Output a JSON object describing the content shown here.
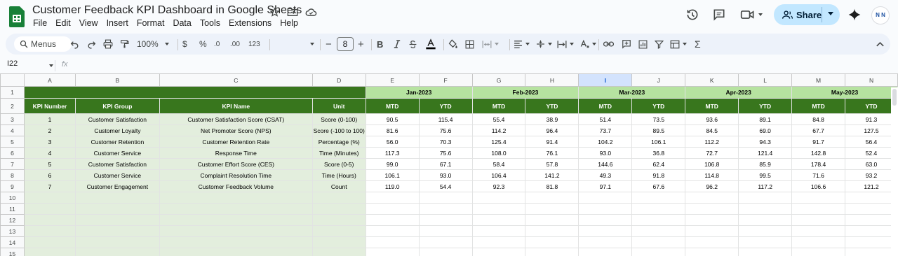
{
  "app": {
    "doc_title": "Customer Feedback KPI Dashboard in Google Sheets",
    "menu": [
      "File",
      "Edit",
      "View",
      "Insert",
      "Format",
      "Data",
      "Tools",
      "Extensions",
      "Help"
    ],
    "share_label": "Share",
    "avatar_text": "N N",
    "brand_color": "#188038",
    "share_bg": "#c2e7ff"
  },
  "toolbar": {
    "menus_label": "Menus",
    "zoom": "100%",
    "currency": "$",
    "percent": "%",
    "dec_dec": ".0",
    "dec_inc": ".00",
    "number_format": "123",
    "font_size": "8",
    "minus": "−",
    "plus": "+",
    "bold": "B",
    "sum": "Σ"
  },
  "formula_bar": {
    "cell_ref": "I22",
    "fx": "fx",
    "content": ""
  },
  "sheet": {
    "selected_column": "I",
    "column_letters": [
      "A",
      "B",
      "C",
      "D",
      "E",
      "F",
      "G",
      "H",
      "I",
      "J",
      "K",
      "L",
      "M",
      "N"
    ],
    "months": [
      "Jan-2023",
      "Feb-2023",
      "Mar-2023",
      "Apr-2023",
      "May-2023"
    ],
    "headers": [
      "KPI Number",
      "KPI Group",
      "KPI Name",
      "Unit"
    ],
    "sub_headers": [
      "MTD",
      "YTD"
    ],
    "rows": [
      {
        "num": "1",
        "group": "Customer Satisfaction",
        "name": "Customer Satisfaction Score (CSAT)",
        "unit": "Score (0-100)",
        "vals": [
          "90.5",
          "115.4",
          "55.4",
          "38.9",
          "51.4",
          "73.5",
          "93.6",
          "89.1",
          "84.8",
          "91.3"
        ]
      },
      {
        "num": "2",
        "group": "Customer Loyalty",
        "name": "Net Promoter Score (NPS)",
        "unit": "Score (-100 to 100)",
        "vals": [
          "81.6",
          "75.6",
          "114.2",
          "96.4",
          "73.7",
          "89.5",
          "84.5",
          "69.0",
          "67.7",
          "127.5"
        ]
      },
      {
        "num": "3",
        "group": "Customer Retention",
        "name": "Customer Retention Rate",
        "unit": "Percentage (%)",
        "vals": [
          "56.0",
          "70.3",
          "125.4",
          "91.4",
          "104.2",
          "106.1",
          "112.2",
          "94.3",
          "91.7",
          "56.4"
        ]
      },
      {
        "num": "4",
        "group": "Customer Service",
        "name": "Response Time",
        "unit": "Time (Minutes)",
        "vals": [
          "117.3",
          "75.6",
          "108.0",
          "76.1",
          "93.0",
          "36.8",
          "72.7",
          "121.4",
          "142.8",
          "52.4"
        ]
      },
      {
        "num": "5",
        "group": "Customer Satisfaction",
        "name": "Customer Effort Score (CES)",
        "unit": "Score (0-5)",
        "vals": [
          "99.0",
          "67.1",
          "58.4",
          "57.8",
          "144.6",
          "62.4",
          "106.8",
          "85.9",
          "178.4",
          "63.0"
        ]
      },
      {
        "num": "6",
        "group": "Customer Service",
        "name": "Complaint Resolution Time",
        "unit": "Time (Hours)",
        "vals": [
          "106.1",
          "93.0",
          "106.4",
          "141.2",
          "49.3",
          "91.8",
          "114.8",
          "99.5",
          "71.6",
          "93.2"
        ]
      },
      {
        "num": "7",
        "group": "Customer Engagement",
        "name": "Customer Feedback Volume",
        "unit": "Count",
        "vals": [
          "119.0",
          "54.4",
          "92.3",
          "81.8",
          "97.1",
          "67.6",
          "96.2",
          "117.2",
          "106.6",
          "121.2"
        ]
      }
    ],
    "empty_row_numbers": [
      "10",
      "11",
      "12",
      "13",
      "14",
      "15"
    ],
    "colors": {
      "dark_green": "#38761d",
      "light_green": "#b6e3a0",
      "pale_green": "#e3eedd"
    }
  }
}
